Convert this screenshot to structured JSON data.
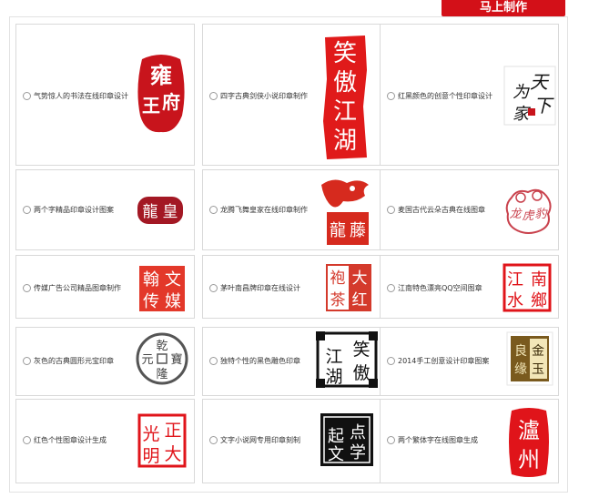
{
  "header": {
    "make_button": "马上制作"
  },
  "accent_color": "#d31018",
  "designs": [
    {
      "label": "气势惊人的书法在线印章设计",
      "seal_text": [
        "雍",
        "府",
        "王"
      ]
    },
    {
      "label": "四字古典剑侠小说印章制作",
      "seal_text": [
        "笑",
        "傲",
        "江",
        "湖"
      ]
    },
    {
      "label": "红黑颜色的创意个性印章设计",
      "seal_text": [
        "天",
        "下",
        "为",
        "家"
      ]
    },
    {
      "label": "两个字精品印章设计图案",
      "seal_text": [
        "龍",
        "皇"
      ]
    },
    {
      "label": "龙腾飞舞皇家在线印章制作",
      "seal_text": [
        "龍",
        "藤"
      ]
    },
    {
      "label": "麦国古代云朵古典在线图章",
      "seal_text": [
        "龙",
        "虎",
        "豹"
      ]
    },
    {
      "label": "传媒广告公司精品图章制作",
      "seal_text": [
        "翰",
        "文",
        "传",
        "媒"
      ]
    },
    {
      "label": "茅叶南昌牌印章在线设计",
      "seal_text": [
        "大",
        "红",
        "袍",
        "茶"
      ]
    },
    {
      "label": "江南特色漂亮QQ空间图章",
      "seal_text": [
        "江",
        "南",
        "水",
        "鄉"
      ]
    },
    {
      "label": "灰色的古典圆形元宝印章",
      "seal_text": [
        "乾",
        "隆",
        "元",
        "寶"
      ]
    },
    {
      "label": "独特个性的黑色雕色印章",
      "seal_text": [
        "笑",
        "傲",
        "江",
        "湖"
      ]
    },
    {
      "label": "2014手工创意设计印章图案",
      "seal_text": [
        "金",
        "玉",
        "良",
        "缘"
      ]
    },
    {
      "label": "红色个性图章设计生成",
      "seal_text": [
        "正",
        "大",
        "光",
        "明"
      ]
    },
    {
      "label": "文字小说网专用印章刻制",
      "seal_text": [
        "点",
        "学",
        "起",
        "文"
      ]
    },
    {
      "label": "两个繁体字在线图章生成",
      "seal_text": [
        "瀘",
        "州"
      ]
    }
  ]
}
